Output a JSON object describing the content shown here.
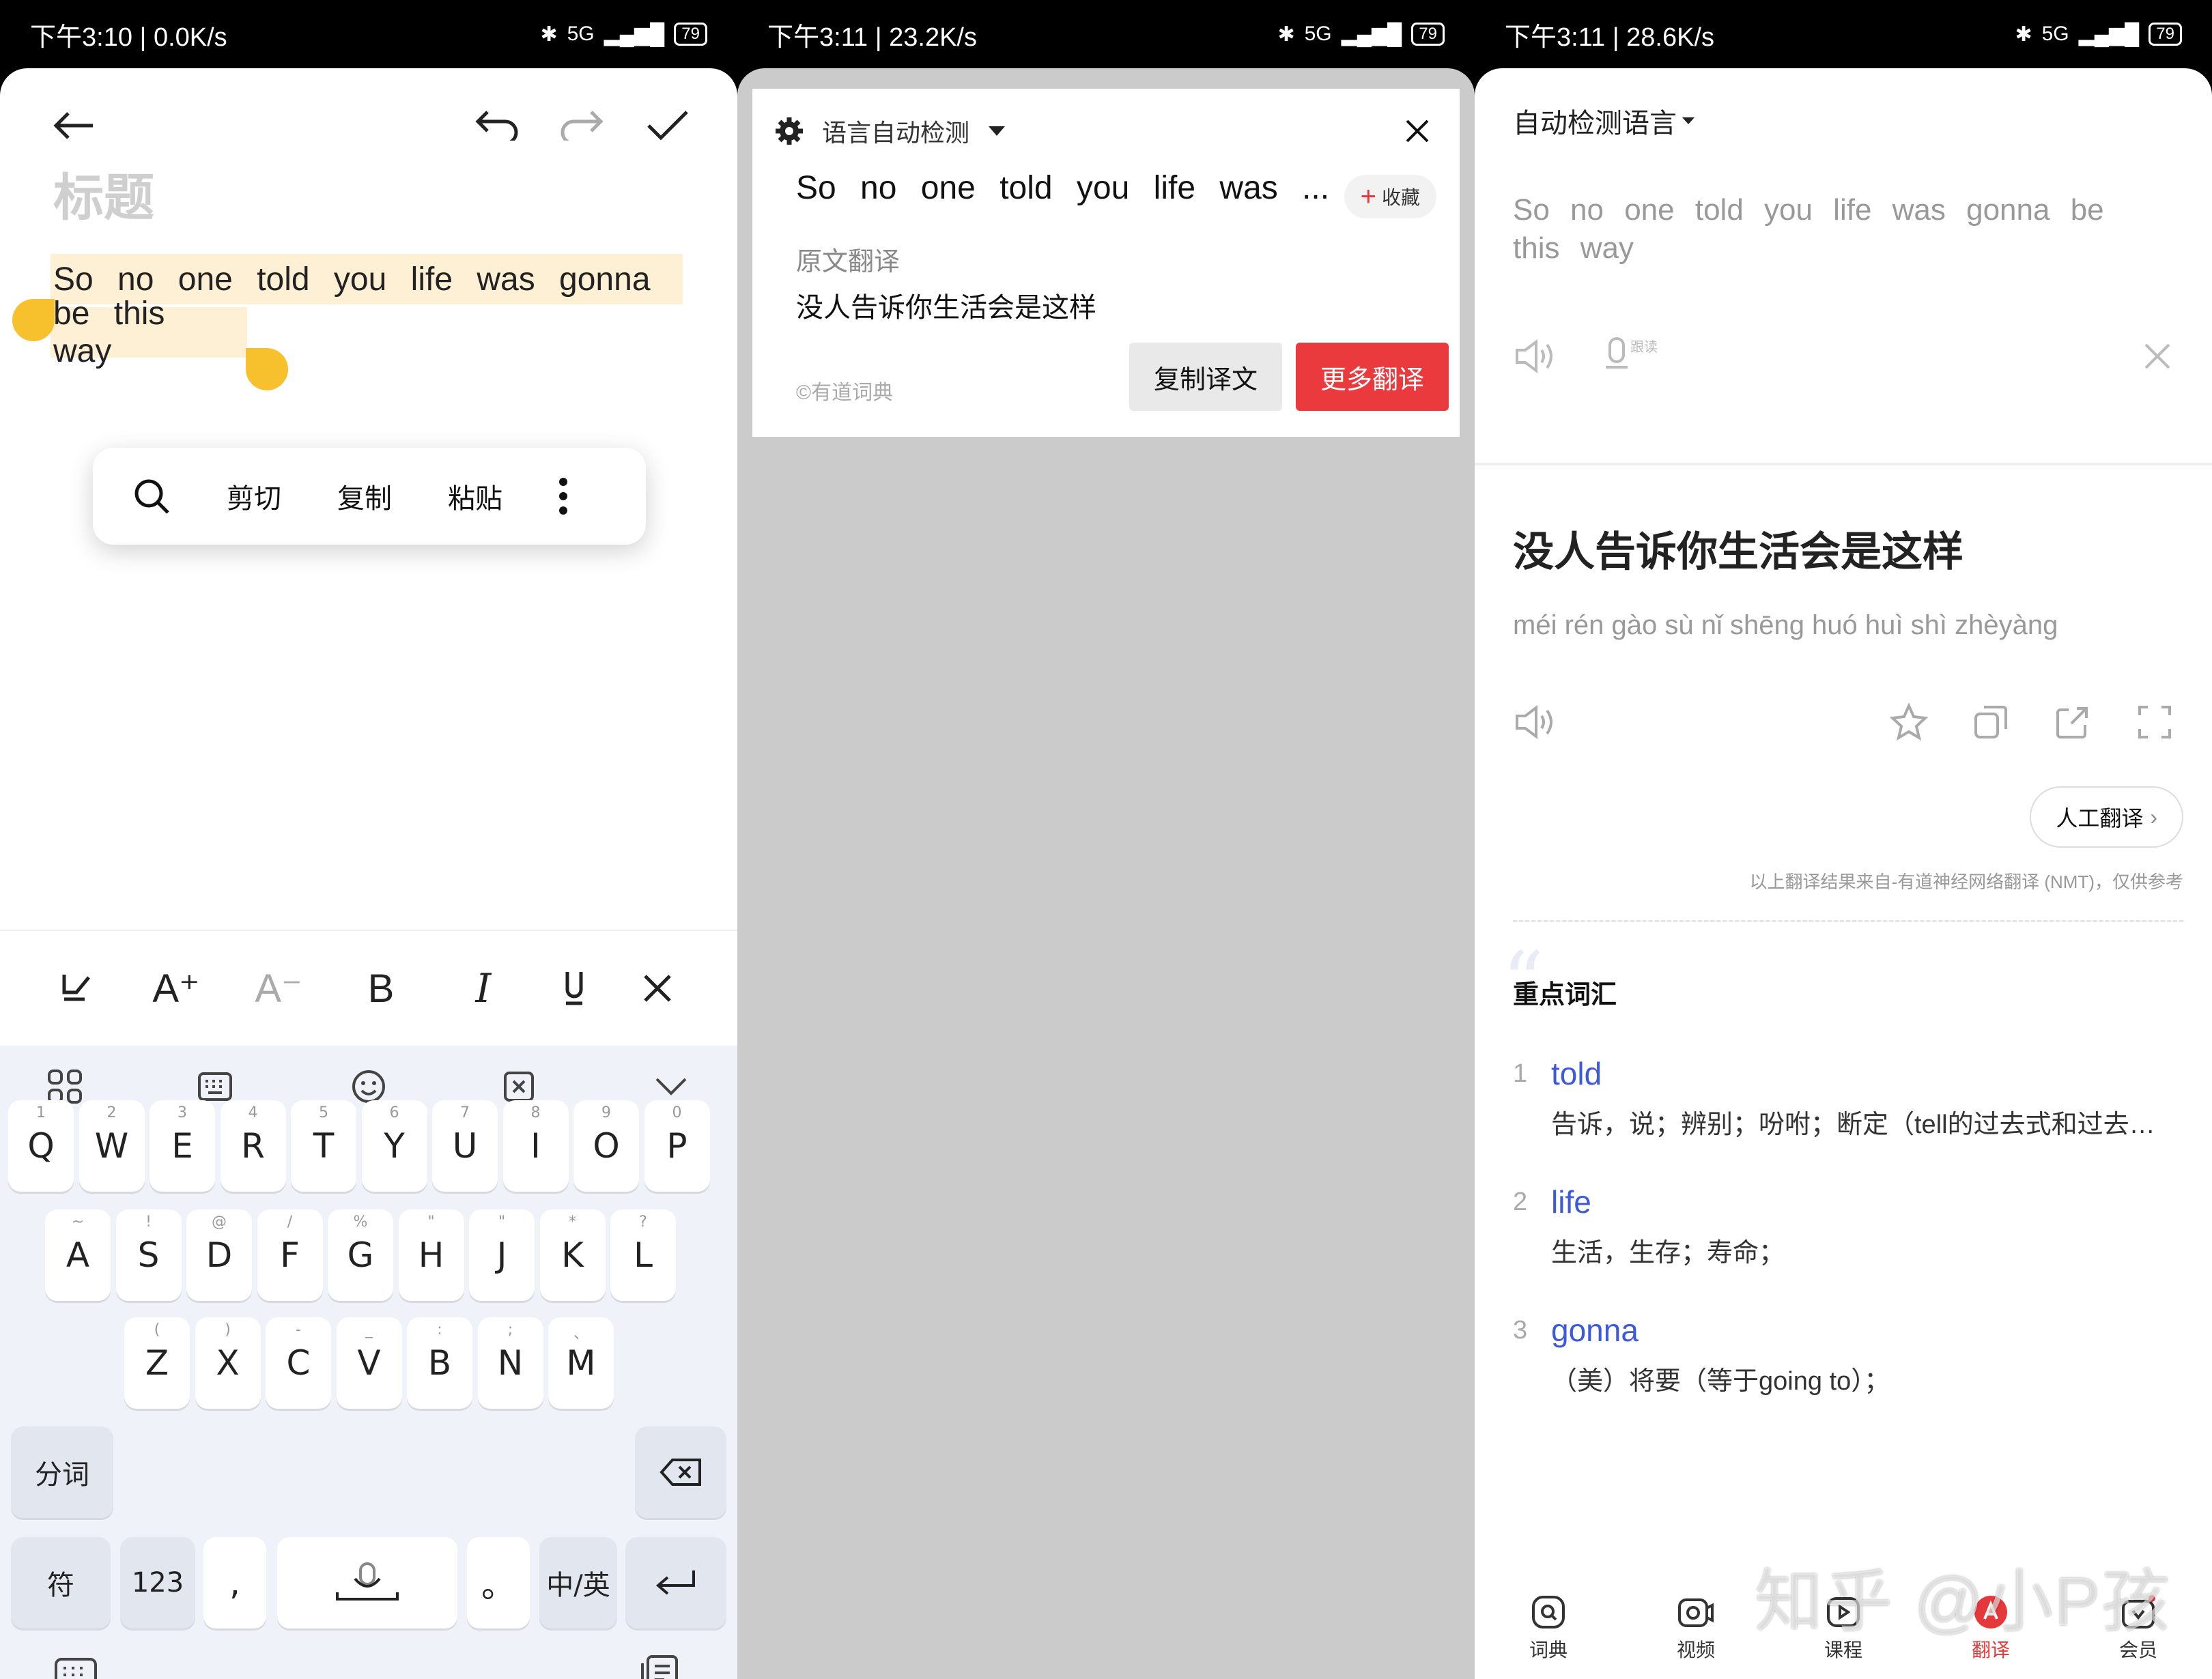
{
  "phones": [
    {
      "status": {
        "time_net": "下午3:10 | 0.0K/s",
        "network": "5G",
        "battery": "79"
      },
      "editor": {
        "title_placeholder": "标题",
        "line1": "So no one told you life was gonna",
        "line2": "be this way"
      },
      "context_menu": {
        "cut": "剪切",
        "copy": "复制",
        "paste": "粘贴"
      },
      "format_bar": {
        "increase": "A⁺",
        "decrease": "A⁻",
        "bold": "B",
        "italic": "I"
      },
      "keyboard": {
        "row1": [
          {
            "k": "Q",
            "s": "1"
          },
          {
            "k": "W",
            "s": "2"
          },
          {
            "k": "E",
            "s": "3"
          },
          {
            "k": "R",
            "s": "4"
          },
          {
            "k": "T",
            "s": "5"
          },
          {
            "k": "Y",
            "s": "6"
          },
          {
            "k": "U",
            "s": "7"
          },
          {
            "k": "I",
            "s": "8"
          },
          {
            "k": "O",
            "s": "9"
          },
          {
            "k": "P",
            "s": "0"
          }
        ],
        "row2": [
          {
            "k": "A",
            "s": "~"
          },
          {
            "k": "S",
            "s": "!"
          },
          {
            "k": "D",
            "s": "@"
          },
          {
            "k": "F",
            "s": "/"
          },
          {
            "k": "G",
            "s": "%"
          },
          {
            "k": "H",
            "s": "\""
          },
          {
            "k": "J",
            "s": "\""
          },
          {
            "k": "K",
            "s": "*"
          },
          {
            "k": "L",
            "s": "?"
          }
        ],
        "row3": [
          {
            "k": "Z",
            "s": "("
          },
          {
            "k": "X",
            "s": ")"
          },
          {
            "k": "C",
            "s": "-"
          },
          {
            "k": "V",
            "s": "_"
          },
          {
            "k": "B",
            "s": ":"
          },
          {
            "k": "N",
            "s": ";"
          },
          {
            "k": "M",
            "s": "、"
          }
        ],
        "segment_key": "分词",
        "symbol_key": "符",
        "num_key": "123",
        "comma_key": ",",
        "period_key": "。",
        "lang_key": "中/英"
      }
    },
    {
      "status": {
        "time_net": "下午3:11 | 23.2K/s",
        "network": "5G",
        "battery": "79"
      },
      "popup": {
        "language": "语言自动检测",
        "source": "So no one told you life was ...",
        "favorite": "收藏",
        "section_label": "原文翻译",
        "translation": "没人告诉你生活会是这样",
        "copyright": "©有道词典",
        "copy_button": "复制译文",
        "more_button": "更多翻译"
      }
    },
    {
      "status": {
        "time_net": "下午3:11 | 28.6K/s",
        "network": "5G",
        "battery": "79"
      },
      "translator": {
        "language": "自动检测语言",
        "source": "So no one told you life was gonna be this way",
        "follow_read": "跟读",
        "translation": "没人告诉你生活会是这样",
        "pinyin": "méi rén gào sù nǐ shēng huó huì shì zhèyàng",
        "human_translate": "人工翻译",
        "nmt_note": "以上翻译结果来自-有道神经网络翻译 (NMT)，仅供参考",
        "keywords_title": "重点词汇",
        "keywords": [
          {
            "n": "1",
            "word": "told",
            "def": "告诉，说；辨别；吩咐；断定（tell的过去式和过去分词）"
          },
          {
            "n": "2",
            "word": "life",
            "def": "生活，生存；寿命；"
          },
          {
            "n": "3",
            "word": "gonna",
            "def": "（美）将要（等于going to）；"
          }
        ],
        "tabs": [
          {
            "label": "词典",
            "icon": "dictionary-icon"
          },
          {
            "label": "视频",
            "icon": "video-icon"
          },
          {
            "label": "课程",
            "icon": "course-icon"
          },
          {
            "label": "翻译",
            "icon": "translate-icon"
          },
          {
            "label": "会员",
            "icon": "member-icon"
          }
        ],
        "watermark": "知乎 @小P孩"
      }
    }
  ],
  "colors": {
    "accent_red": "#e5383b",
    "link_blue": "#3d5adb",
    "highlight": "#fdf0d5",
    "handle": "#f7c12d"
  }
}
